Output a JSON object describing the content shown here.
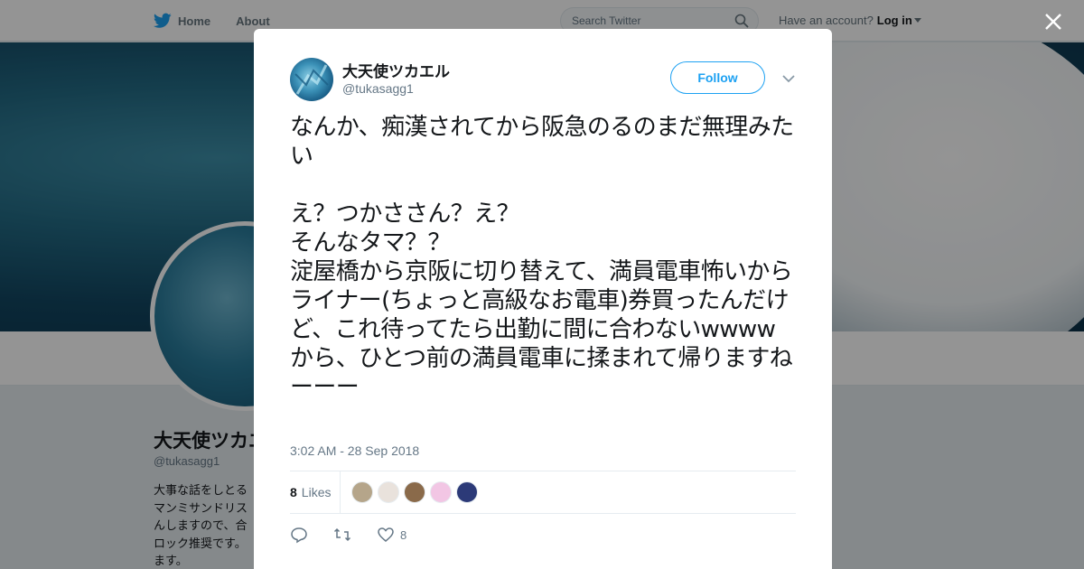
{
  "topbar": {
    "nav_links": [
      "Home",
      "About"
    ],
    "search_placeholder": "Search Twitter",
    "account_prompt": "Have an account?",
    "login_label": "Log in"
  },
  "background_profile": {
    "name": "大天使ツカエル",
    "handle": "@tukasagg1",
    "bio_visible": "大事な話をしとる\nマンミサンドリス\nんしますので、合\nロック推奨です。\nます。"
  },
  "tweet": {
    "author_name": "大天使ツカエル",
    "author_handle": "@tukasagg1",
    "follow_label": "Follow",
    "text": "なんか、痴漢されてから阪急のるのまだ無理みたい\n\nえ？つかささん？え？\nそんなタマ？？\n淀屋橋から京阪に切り替えて、満員電車怖いからライナー(ちょっと高級なお電車)券買ったんだけど、これ待ってたら出勤に間に合わないwwww\nから、ひとつ前の満員電車に揉まれて帰りますねーーー",
    "timestamp": "3:02 AM - 28 Sep 2018",
    "likes_count": "8",
    "likes_label": "Likes",
    "like_action_count": "8",
    "liker_colors": [
      "#b5a58a",
      "#e9e2dc",
      "#8a6a4a",
      "#f2c6e4",
      "#2c3a78"
    ]
  },
  "icons": [
    "twitter-bird-icon",
    "search-icon",
    "close-icon",
    "chevron-down-icon",
    "reply-icon",
    "retweet-icon",
    "heart-icon"
  ]
}
